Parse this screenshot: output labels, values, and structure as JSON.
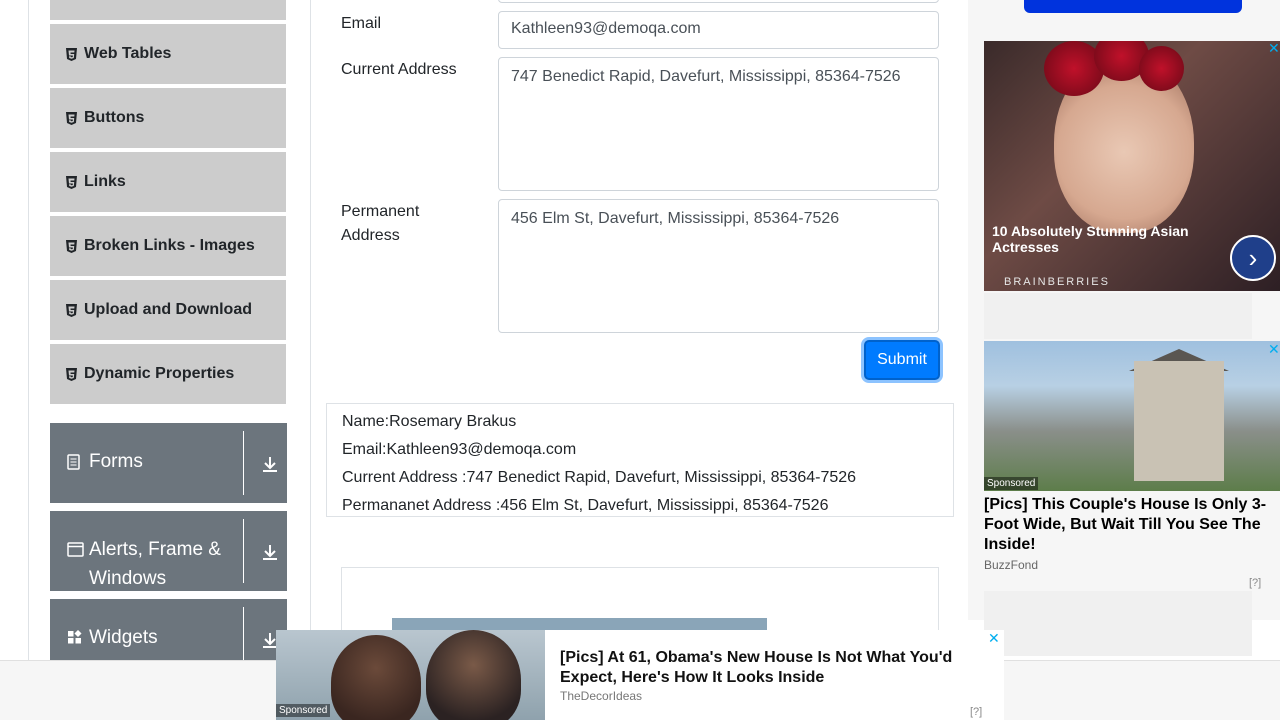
{
  "sidebar": {
    "items": [
      {
        "label": "Web Tables"
      },
      {
        "label": "Buttons"
      },
      {
        "label": "Links"
      },
      {
        "label": "Broken Links - Images"
      },
      {
        "label": "Upload and Download"
      },
      {
        "label": "Dynamic Properties"
      }
    ],
    "groups": [
      {
        "label": "Forms"
      },
      {
        "label": "Alerts, Frame &",
        "label2": "Windows"
      },
      {
        "label": "Widgets"
      }
    ]
  },
  "form": {
    "email_label": "Email",
    "email_value": "Kathleen93@demoqa.com",
    "current_address_label": "Current Address",
    "current_address_value": "747 Benedict Rapid, Davefurt, Mississippi, 85364-7526",
    "permanent_address_label_1": "Permanent",
    "permanent_address_label_2": "Address",
    "permanent_address_value": "456 Elm St, Davefurt, Mississippi, 85364-7526",
    "submit_label": "Submit"
  },
  "output": {
    "name": "Name:Rosemary Brakus",
    "email": "Email:Kathleen93@demoqa.com",
    "current_address": "Current Address :747 Benedict Rapid, Davefurt, Mississippi, 85364-7526",
    "permanent_address": "Permananet Address :456 Elm St, Davefurt, Mississippi, 85364-7526"
  },
  "ads": {
    "ad1_title": "10 Absolutely Stunning Asian Actresses",
    "ad1_brand": "BRAINBERRIES",
    "ad2_sponsored": "Sponsored",
    "ad2_title": "[Pics] This Couple's House Is Only 3-Foot Wide, But Wait Till You See The Inside!",
    "ad2_source": "BuzzFond",
    "adchoice": "[?]",
    "banner_sponsored": "Sponsored",
    "banner_title": "[Pics] At 61, Obama's New House Is Not What You'd Expect, Here's How It Looks Inside",
    "banner_source": "TheDecorIdeas"
  },
  "colors": {
    "primary": "#007bff",
    "sidebar_group": "#6c757d",
    "menu_item": "#cccccc"
  }
}
